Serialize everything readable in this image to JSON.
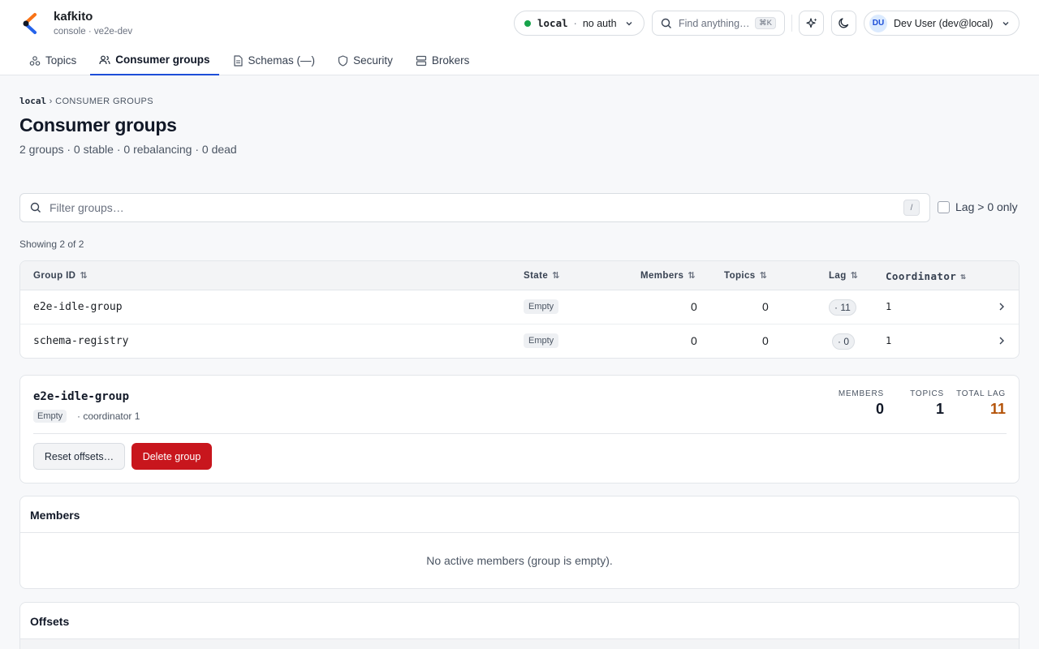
{
  "app": {
    "name": "kafkito",
    "subtitle": "console · ve2e-dev"
  },
  "connection": {
    "name": "local",
    "auth": "no auth",
    "status_color": "#16a34a"
  },
  "search": {
    "placeholder": "Find anything…",
    "shortcut": "⌘K"
  },
  "user": {
    "initials": "DU",
    "label": "Dev User (dev@local)"
  },
  "tabs": [
    {
      "label": "Topics",
      "icon": "topics-icon"
    },
    {
      "label": "Consumer groups",
      "icon": "users-icon",
      "active": true
    },
    {
      "label": "Schemas (—)",
      "icon": "document-icon"
    },
    {
      "label": "Security",
      "icon": "shield-icon"
    },
    {
      "label": "Brokers",
      "icon": "server-icon"
    }
  ],
  "breadcrumb": {
    "cluster": "local",
    "section": "CONSUMER GROUPS"
  },
  "page": {
    "title": "Consumer groups",
    "summary": "2 groups · 0 stable · 0 rebalancing · 0 dead"
  },
  "filter": {
    "placeholder": "Filter groups…",
    "shortcut": "/",
    "lag_only_label": "Lag > 0 only",
    "lag_only_checked": false
  },
  "showing": "Showing 2 of 2",
  "table": {
    "headers": {
      "group_id": "Group ID",
      "state": "State",
      "members": "Members",
      "topics": "Topics",
      "lag": "Lag",
      "coordinator": "Coordinator"
    },
    "rows": [
      {
        "group_id": "e2e-idle-group",
        "state": "Empty",
        "members": "0",
        "topics": "0",
        "lag": "· 11",
        "coordinator": "1"
      },
      {
        "group_id": "schema-registry",
        "state": "Empty",
        "members": "0",
        "topics": "0",
        "lag": "· 0",
        "coordinator": "1"
      }
    ]
  },
  "detail": {
    "group_id": "e2e-idle-group",
    "state": "Empty",
    "coordinator": "· coordinator 1",
    "stats": {
      "members_label": "MEMBERS",
      "members": "0",
      "topics_label": "TOPICS",
      "topics": "1",
      "total_lag_label": "TOTAL LAG",
      "total_lag": "11"
    },
    "lag_color": "#b45309",
    "reset_label": "Reset offsets…",
    "delete_label": "Delete group",
    "delete_color": "#c8161d"
  },
  "members_panel": {
    "title": "Members",
    "empty": "No active members (group is empty)."
  },
  "offsets_panel": {
    "title": "Offsets"
  }
}
